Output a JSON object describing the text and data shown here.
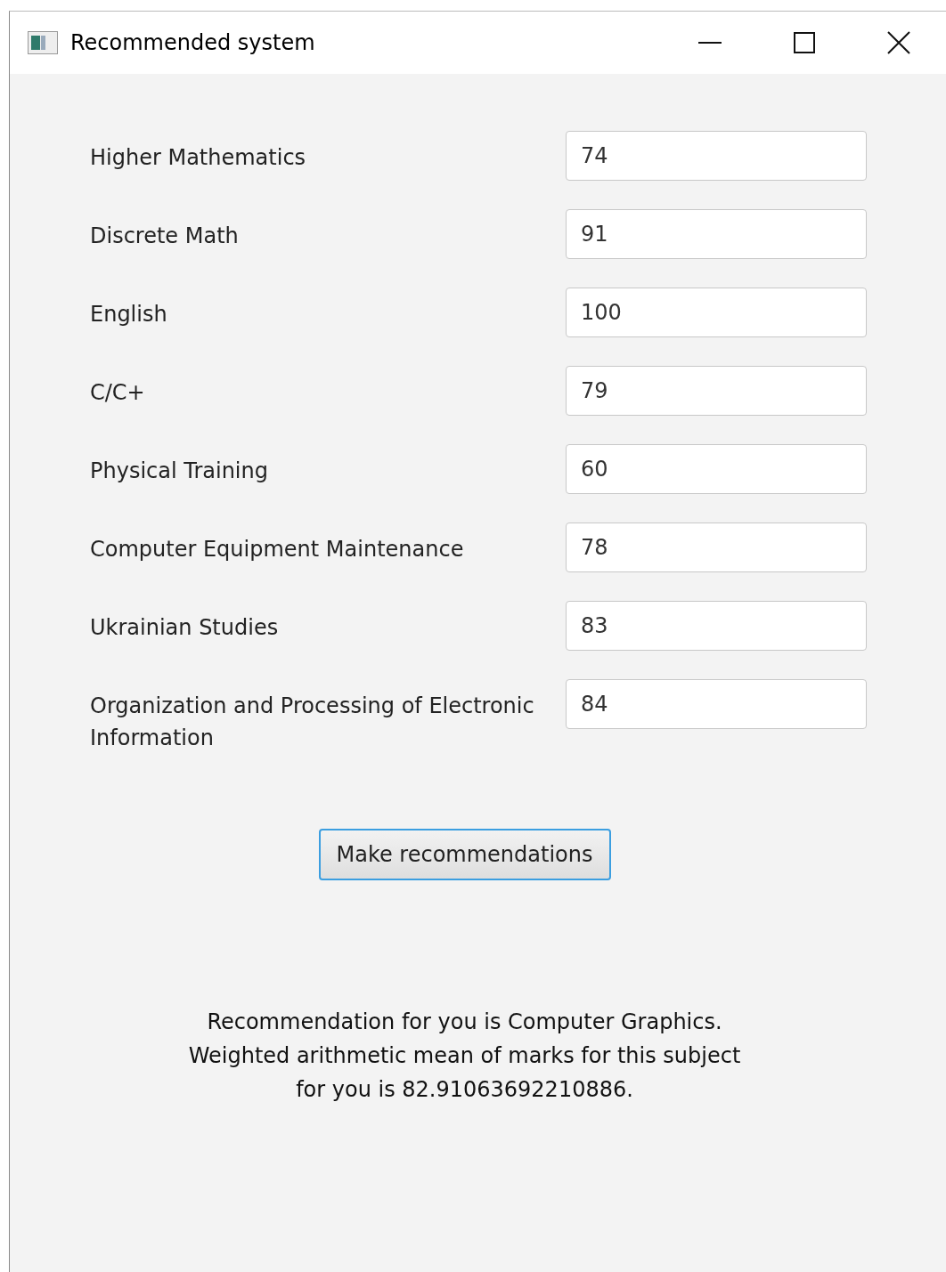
{
  "window": {
    "title": "Recommended system"
  },
  "subjects": [
    {
      "label": "Higher Mathematics",
      "value": "74"
    },
    {
      "label": "Discrete Math",
      "value": "91"
    },
    {
      "label": "English",
      "value": "100"
    },
    {
      "label": "C/C+",
      "value": "79"
    },
    {
      "label": "Physical Training",
      "value": "60"
    },
    {
      "label": "Computer Equipment Maintenance",
      "value": "78"
    },
    {
      "label": "Ukrainian Studies",
      "value": "83"
    },
    {
      "label": "Organization and Processing of Electronic Information",
      "value": "84"
    }
  ],
  "button": "Make recommendations",
  "result": [
    "Recommendation for you is Computer Graphics.",
    "Weighted arithmetic mean of marks for this subject",
    "for you is 82.91063692210886."
  ]
}
